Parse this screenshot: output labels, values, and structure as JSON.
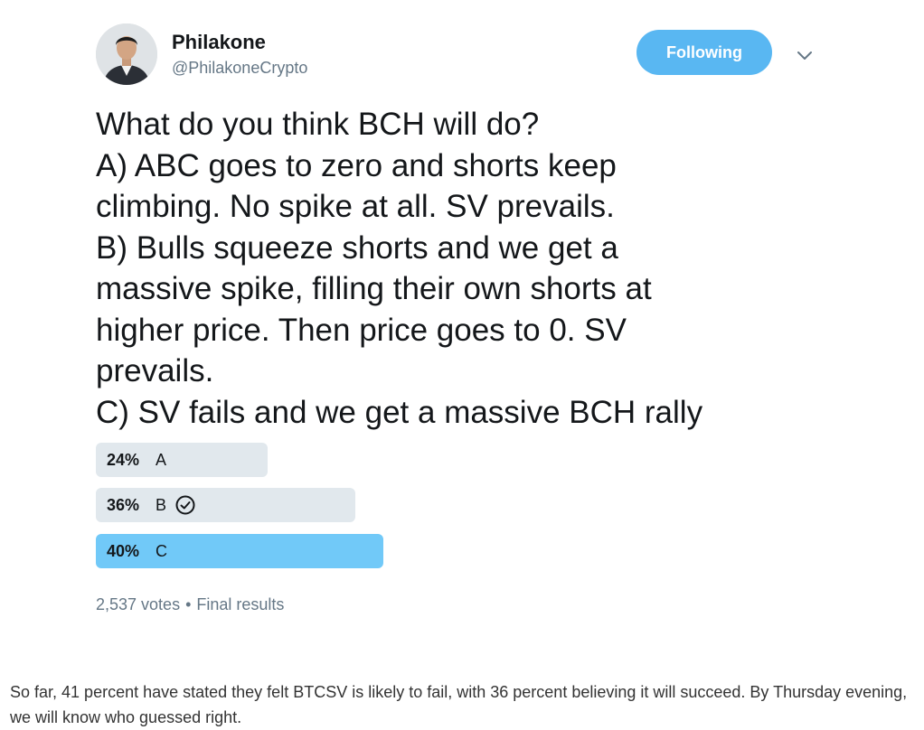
{
  "tweet": {
    "author_name": "Philakone",
    "author_handle": "@PhilakoneCrypto",
    "follow_button_label": "Following",
    "text_lines": [
      "What do you think BCH will do?",
      "A) ABC goes to zero and shorts keep",
      "climbing. No spike at all. SV prevails.",
      "B) Bulls squeeze shorts and we get a",
      "massive spike, filling their own shorts at",
      "higher price. Then price goes to 0. SV",
      "prevails.",
      "C) SV fails and we get a massive BCH rally"
    ],
    "poll": {
      "options": [
        {
          "percent_label": "24%",
          "label": "A",
          "value": 24,
          "selected_by_user": false
        },
        {
          "percent_label": "36%",
          "label": "B",
          "value": 36,
          "selected_by_user": true
        },
        {
          "percent_label": "40%",
          "label": "C",
          "value": 40,
          "selected_by_user": false
        }
      ],
      "votes": "2,537 votes",
      "separator": "•",
      "status": "Final results"
    },
    "icons": {
      "avatar": "avatar-photo",
      "more": "chevron-down-icon",
      "user_vote": "check-circle-icon"
    },
    "colors": {
      "follow_button": "#59b7f2",
      "poll_bar": "#e1e8ed",
      "poll_bar_winner": "#71c9f8",
      "muted_text": "#657786"
    }
  },
  "article": {
    "paragraph": "So far, 41 percent have stated they felt BTCSV is likely to fail, with 36 percent believing it will succeed. By Thursday evening, we will know who guessed right."
  }
}
